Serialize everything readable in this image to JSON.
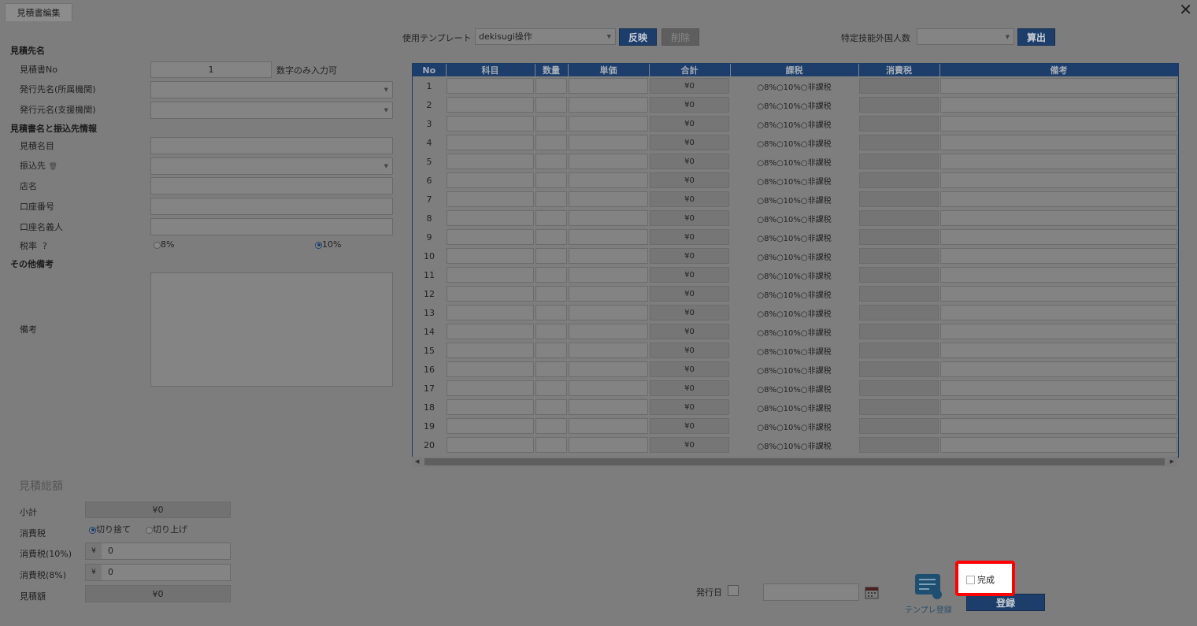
{
  "window": {
    "tab_title": "見積書編集",
    "close_icon": "close-icon"
  },
  "left": {
    "sec_dest": "見積先名",
    "no_label": "見積書No",
    "no_value": "1",
    "no_hint": "数字のみ入力可",
    "issuer_to_label": "発行先名(所属機関)",
    "issuer_from_label": "発行元名(支援機関)",
    "sec_name_bank": "見積書名と振込先情報",
    "item_label": "見積名目",
    "bank_label": "振込先",
    "store_label": "店名",
    "account_label": "口座番号",
    "holder_label": "口座名義人",
    "tax_label": "税率",
    "tax_help": "?",
    "tax_opt_8": "8%",
    "tax_opt_10": "10%",
    "tax_selected": "10%",
    "sec_other": "その他備考",
    "memo_label": "備考"
  },
  "toolbar": {
    "template_label": "使用テンプレート",
    "template_value": "dekisugi操作",
    "apply_button": "反映",
    "delete_button": "削除",
    "foreign_label": "特定技能外国人数",
    "calc_button": "算出"
  },
  "table": {
    "headers": [
      "No",
      "科目",
      "数量",
      "単価",
      "合計",
      "課税",
      "消費税",
      "備考"
    ],
    "rows": [
      {
        "no": "1",
        "total": "¥0"
      },
      {
        "no": "2",
        "total": "¥0"
      },
      {
        "no": "3",
        "total": "¥0"
      },
      {
        "no": "4",
        "total": "¥0"
      },
      {
        "no": "5",
        "total": "¥0"
      },
      {
        "no": "6",
        "total": "¥0"
      },
      {
        "no": "7",
        "total": "¥0"
      },
      {
        "no": "8",
        "total": "¥0"
      },
      {
        "no": "9",
        "total": "¥0"
      },
      {
        "no": "10",
        "total": "¥0"
      },
      {
        "no": "11",
        "total": "¥0"
      },
      {
        "no": "12",
        "total": "¥0"
      },
      {
        "no": "13",
        "total": "¥0"
      },
      {
        "no": "14",
        "total": "¥0"
      },
      {
        "no": "15",
        "total": "¥0"
      },
      {
        "no": "16",
        "total": "¥0"
      },
      {
        "no": "17",
        "total": "¥0"
      },
      {
        "no": "18",
        "total": "¥0"
      },
      {
        "no": "19",
        "total": "¥0"
      },
      {
        "no": "20",
        "total": "¥0"
      }
    ],
    "tax_options": "○8%○10%○非課税"
  },
  "totals": {
    "title": "見積総額",
    "subtotal_label": "小計",
    "subtotal_value": "¥0",
    "tax_label": "消費税",
    "round_down": "切り捨て",
    "round_up": "切り上げ",
    "rounding_selected": "切り捨て",
    "tax10_label": "消費税(10%)",
    "tax10_value": "0",
    "tax8_label": "消費税(8%)",
    "tax8_value": "0",
    "yen": "¥",
    "amount_label": "見積額",
    "amount_value": "¥0"
  },
  "footer": {
    "issue_date_label": "発行日",
    "template_register": "テンプレ登録",
    "complete_label": "完成",
    "register_button": "登録"
  }
}
